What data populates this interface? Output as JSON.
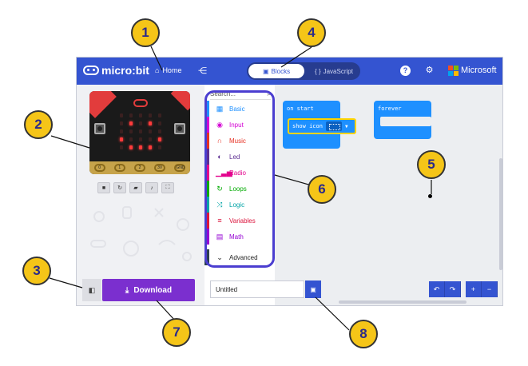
{
  "topbar": {
    "logo_text": "micro:bit",
    "home_label": "Home",
    "blocks_label": "Blocks",
    "javascript_label": "JavaScript",
    "microsoft_label": "Microsoft",
    "colors": {
      "bar": "#3454d1",
      "ms_red": "#f25022",
      "ms_green": "#7fba00",
      "ms_blue": "#00a4ef",
      "ms_yellow": "#ffb900"
    }
  },
  "simulator": {
    "pin_labels": [
      "0",
      "1",
      "2",
      "3V",
      "GND"
    ],
    "led_on": [
      [
        0,
        0,
        0,
        0,
        0
      ],
      [
        0,
        1,
        0,
        1,
        0
      ],
      [
        0,
        0,
        0,
        0,
        0
      ],
      [
        1,
        0,
        0,
        0,
        1
      ],
      [
        0,
        1,
        1,
        1,
        0
      ]
    ],
    "controls": [
      "stop-icon",
      "restart-icon",
      "debug-icon",
      "sound-icon",
      "fullscreen-icon"
    ]
  },
  "toolbox": {
    "search_placeholder": "Search...",
    "categories": [
      {
        "label": "Basic",
        "color": "#1e90ff",
        "icon": "grid-icon"
      },
      {
        "label": "Input",
        "color": "#d400d4",
        "icon": "target-icon"
      },
      {
        "label": "Music",
        "color": "#e63022",
        "icon": "headphones-icon"
      },
      {
        "label": "Led",
        "color": "#5c2d91",
        "icon": "toggle-icon"
      },
      {
        "label": "Radio",
        "color": "#e3008c",
        "icon": "signal-icon"
      },
      {
        "label": "Loops",
        "color": "#00aa00",
        "icon": "refresh-icon"
      },
      {
        "label": "Logic",
        "color": "#00a4a6",
        "icon": "shuffle-icon"
      },
      {
        "label": "Variables",
        "color": "#dc143c",
        "icon": "list-icon"
      },
      {
        "label": "Math",
        "color": "#9400d3",
        "icon": "calculator-icon"
      }
    ],
    "advanced_label": "Advanced"
  },
  "workspace": {
    "on_start_label": "on start",
    "show_icon_label": "show icon",
    "forever_label": "forever"
  },
  "bottombar": {
    "download_label": "Download",
    "project_name": "Untitled"
  },
  "callouts": [
    "1",
    "2",
    "3",
    "4",
    "5",
    "6",
    "7",
    "8"
  ]
}
